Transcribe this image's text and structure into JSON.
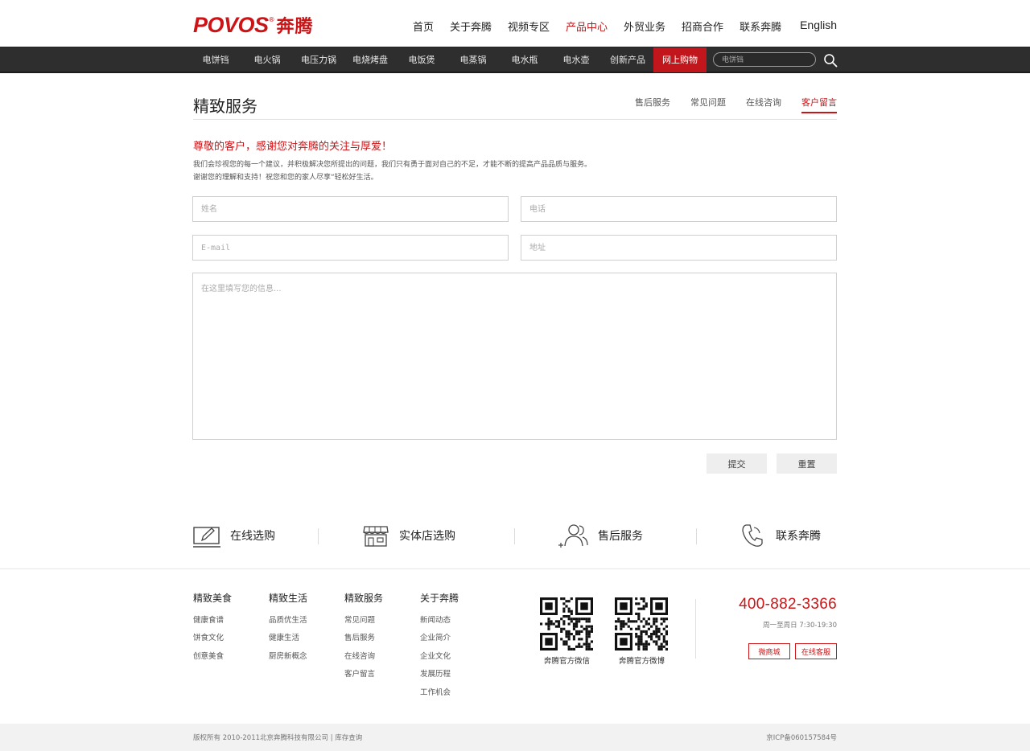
{
  "brand": {
    "latin": "POVOS",
    "reg": "®",
    "cn": "奔腾"
  },
  "topnav": {
    "items": [
      "首页",
      "关于奔腾",
      "视频专区",
      "产品中心",
      "外贸业务",
      "招商合作",
      "联系奔腾"
    ],
    "active": "产品中心",
    "english": "English"
  },
  "categories": [
    "电饼铛",
    "电火锅",
    "电压力锅",
    "电烧烤盘",
    "电饭煲",
    "电蒸锅",
    "电水瓶",
    "电水壶",
    "创新产品",
    "网上购物"
  ],
  "search": {
    "placeholder": "电饼铛"
  },
  "page": {
    "title": "精致服务",
    "subnav": [
      "售后服务",
      "常见问题",
      "在线咨询",
      "客户留言"
    ],
    "active_subnav": "客户留言"
  },
  "intro": {
    "heading": "尊敬的客户，感谢您对奔腾的关注与厚爱！",
    "line1": "我们会珍视您的每一个建议，并积极解决您所提出的问题，我们只有勇于面对自己的不足，才能不断的提高产品品质与服务。",
    "line2": "谢谢您的理解和支持！祝您和您的家人尽享“轻松好生活。"
  },
  "form": {
    "name_placeholder": "姓名",
    "phone_placeholder": "电话",
    "email_placeholder": "E-mail",
    "address_placeholder": "地址",
    "message_placeholder": "在这里填写您的信息...",
    "submit_label": "提交",
    "reset_label": "重置"
  },
  "services": [
    "在线选购",
    "实体店选购",
    "售后服务",
    "联系奔腾"
  ],
  "footer": {
    "columns": [
      {
        "title": "精致美食",
        "links": [
          "健康食谱",
          "饼食文化",
          "创意美食"
        ]
      },
      {
        "title": "精致生活",
        "links": [
          "品质优生活",
          "健康生活",
          "厨房新概念"
        ]
      },
      {
        "title": "精致服务",
        "links": [
          "常见问题",
          "售后服务",
          "在线咨询",
          "客户留言"
        ]
      },
      {
        "title": "关于奔腾",
        "links": [
          "新闻动态",
          "企业简介",
          "企业文化",
          "发展历程",
          "工作机会"
        ]
      }
    ],
    "qr_wechat": "奔腾官方微信",
    "qr_weibo": "奔腾官方微博",
    "phone": "400-882-3366",
    "hours": "周一至周日 7:30-19:30",
    "btn_mall": "微商城",
    "btn_service": "在线客服",
    "copyright": "版权所有 2010-2011北京奔腾科技有限公司 | 库存查询",
    "icp": "京ICP备060157584号"
  },
  "colors": {
    "accent": "#cc1417",
    "navbar": "#2e2e2e",
    "button_bg": "#eeeeee"
  }
}
